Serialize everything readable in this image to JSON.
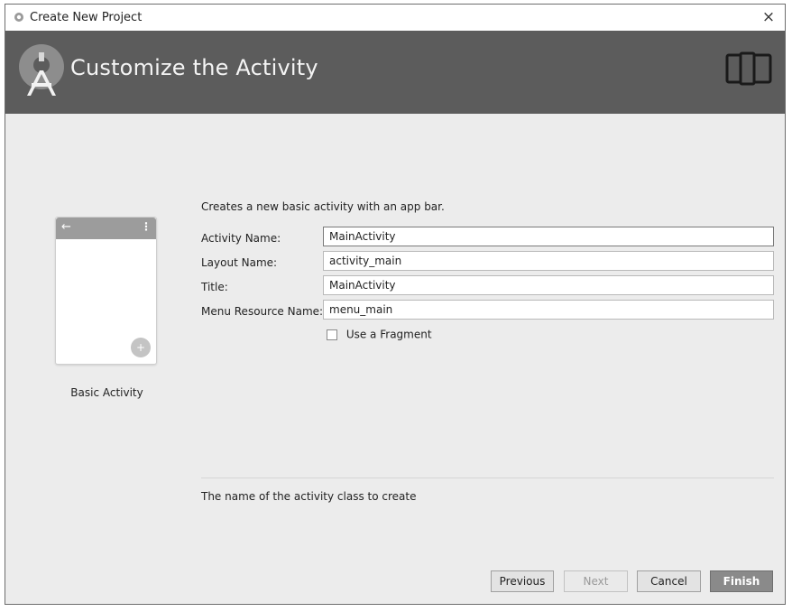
{
  "window": {
    "title": "Create New Project",
    "close_glyph": "×"
  },
  "header": {
    "title": "Customize the Activity",
    "logo_icon": "android-studio-logo-icon",
    "device_icon": "tablet-phone-icon"
  },
  "preview": {
    "label": "Basic Activity",
    "back_glyph": "←",
    "overflow_glyph": "⋮",
    "fab_glyph": "+"
  },
  "form": {
    "description": "Creates a new basic activity with an app bar.",
    "fields": [
      {
        "label": "Activity Name:",
        "value": "MainActivity"
      },
      {
        "label": "Layout Name:",
        "value": "activity_main"
      },
      {
        "label": "Title:",
        "value": "MainActivity"
      },
      {
        "label": "Menu Resource Name:",
        "value": "menu_main"
      }
    ],
    "use_fragment": {
      "label": "Use a Fragment",
      "checked": false
    }
  },
  "hint": "The name of the activity class to create",
  "buttons": {
    "previous": "Previous",
    "next": "Next",
    "cancel": "Cancel",
    "finish": "Finish"
  },
  "colors": {
    "header_bg": "#5c5c5c",
    "body_bg": "#ececec",
    "finish_bg": "#8a8a8a"
  }
}
